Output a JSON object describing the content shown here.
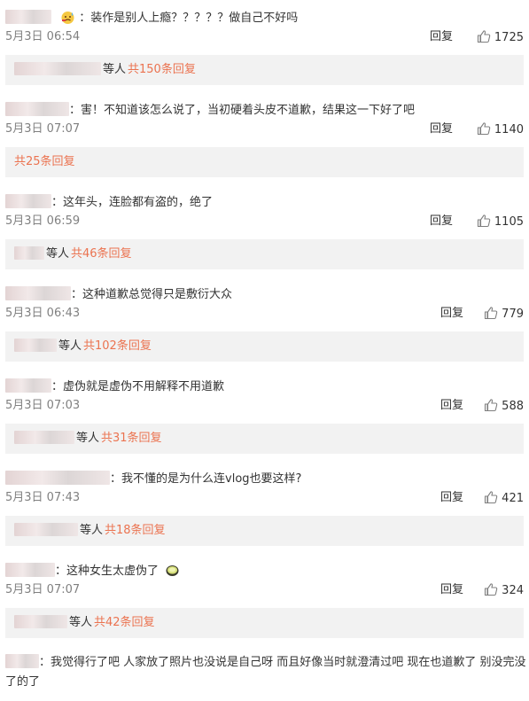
{
  "reply_label": "回复",
  "others_label": "等人",
  "comments": [
    {
      "text": "装作是别人上瘾？？？？？做自己不好吗",
      "time": "5月3日 06:54",
      "likes": "1725",
      "subreplies": "共150条回复"
    },
    {
      "text": "害！不知道该怎么说了，当初硬着头皮不道歉，结果这一下好了吧",
      "time": "5月3日 07:07",
      "likes": "1140",
      "subreplies": "共25条回复"
    },
    {
      "text": "这年头，连脸都有盗的，绝了",
      "time": "5月3日 06:59",
      "likes": "1105",
      "subreplies": "共46条回复"
    },
    {
      "text": "这种道歉总觉得只是敷衍大众",
      "time": "5月3日 06:43",
      "likes": "779",
      "subreplies": "共102条回复"
    },
    {
      "text": "虚伪就是虚伪不用解释不用道歉",
      "time": "5月3日 07:03",
      "likes": "588",
      "subreplies": "共31条回复"
    },
    {
      "text": "我不懂的是为什么连vlog也要这样?",
      "time": "5月3日 07:43",
      "likes": "421",
      "subreplies": "共18条回复"
    },
    {
      "text": "这种女生太虚伪了",
      "time": "5月3日 07:07",
      "likes": "324",
      "subreplies": "共42条回复"
    }
  ],
  "last_comment": {
    "text": "我觉得行了吧 人家放了照片也没说是自己呀 而且好像当时就澄清过吧 现在也道歉了 别没完没了的了"
  },
  "colors": {
    "accent": "#eb7350",
    "subbar_bg": "#f2f2f2",
    "meta_text": "#808080"
  },
  "icons": {
    "like": "thumbs-up-icon",
    "emoji_1": "sweat-face-emoji-icon",
    "emoji_7": "matcha-cup-emoji-icon"
  }
}
